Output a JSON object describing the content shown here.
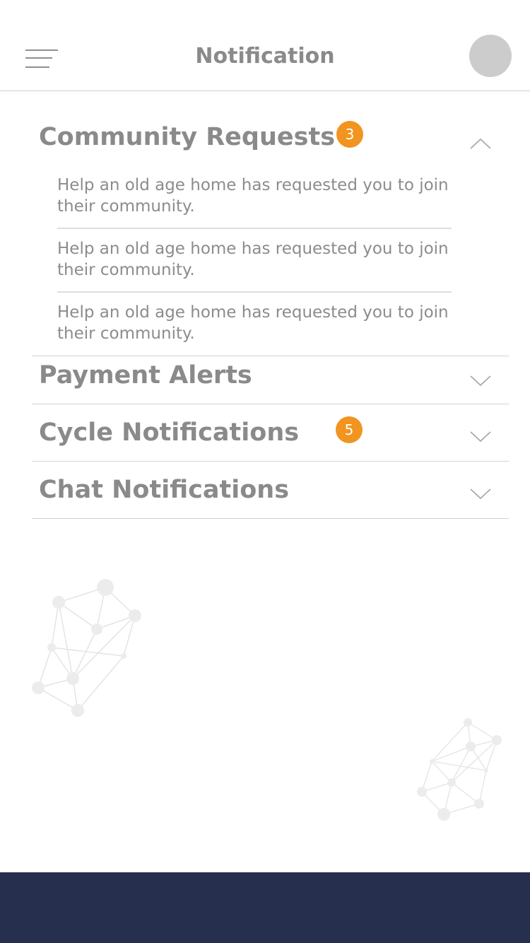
{
  "header": {
    "title": "Notification",
    "menu_icon": "hamburger-icon"
  },
  "sections": [
    {
      "title": "Community Requests",
      "badge": "3",
      "expanded": true,
      "items": [
        "Help an old age home has requested you to join their community.",
        "Help an old age home has requested you to join their community.",
        "Help an old age home has requested you to join their community."
      ]
    },
    {
      "title": "Payment Alerts",
      "expanded": false
    },
    {
      "title": "Cycle Notifications",
      "badge": "5",
      "expanded": false
    },
    {
      "title": "Chat Notifications",
      "expanded": false
    }
  ],
  "colors": {
    "badge": "#f29420",
    "footer": "#262f4d",
    "avatar": "#cccccc"
  }
}
